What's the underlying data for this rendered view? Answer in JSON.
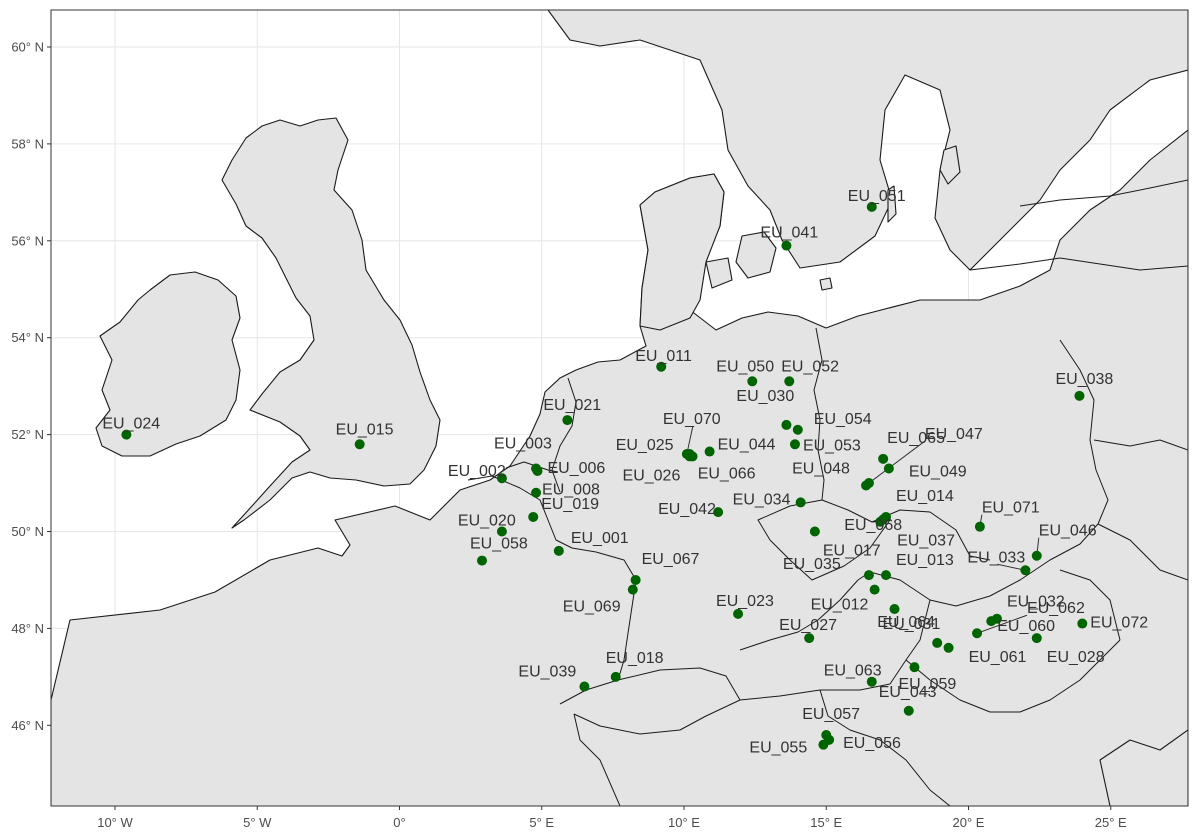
{
  "map": {
    "x_range": [
      -11,
      27
    ],
    "y_range": [
      44.4,
      60.75
    ],
    "x_ticks": [
      {
        "value": -10,
        "label": "10° W"
      },
      {
        "value": -5,
        "label": "5° W"
      },
      {
        "value": 0,
        "label": "0°"
      },
      {
        "value": 5,
        "label": "5° E"
      },
      {
        "value": 10,
        "label": "10° E"
      },
      {
        "value": 15,
        "label": "15° E"
      },
      {
        "value": 20,
        "label": "20° E"
      },
      {
        "value": 25,
        "label": "25° E"
      }
    ],
    "y_ticks": [
      {
        "value": 46,
        "label": "46° N"
      },
      {
        "value": 48,
        "label": "48° N"
      },
      {
        "value": 50,
        "label": "50° N"
      },
      {
        "value": 52,
        "label": "52° N"
      },
      {
        "value": 54,
        "label": "54° N"
      },
      {
        "value": 56,
        "label": "56° N"
      },
      {
        "value": 58,
        "label": "58° N"
      },
      {
        "value": 60,
        "label": "60° N"
      }
    ],
    "colors": {
      "land": "#e4e4e4",
      "sea": "#ffffff",
      "outline": "#1a1a1a",
      "point": "#006400",
      "grid": "#e6e6e6",
      "label": "#333333"
    }
  },
  "sites": [
    {
      "id": "EU_001",
      "lon": 5.6,
      "lat": 49.6
    },
    {
      "id": "EU_002",
      "lon": 3.6,
      "lat": 51.1
    },
    {
      "id": "EU_003",
      "lon": 4.8,
      "lat": 51.3
    },
    {
      "id": "EU_006",
      "lon": 4.85,
      "lat": 51.25
    },
    {
      "id": "EU_008",
      "lon": 4.8,
      "lat": 50.8
    },
    {
      "id": "EU_011",
      "lon": 9.2,
      "lat": 53.4
    },
    {
      "id": "EU_012",
      "lon": 16.7,
      "lat": 48.8
    },
    {
      "id": "EU_013",
      "lon": 17.1,
      "lat": 49.1
    },
    {
      "id": "EU_014",
      "lon": 17.1,
      "lat": 50.3
    },
    {
      "id": "EU_015",
      "lon": -1.4,
      "lat": 51.8
    },
    {
      "id": "EU_017",
      "lon": 14.6,
      "lat": 50.0
    },
    {
      "id": "EU_018",
      "lon": 7.6,
      "lat": 47.0
    },
    {
      "id": "EU_019",
      "lon": 4.7,
      "lat": 50.3
    },
    {
      "id": "EU_020",
      "lon": 3.6,
      "lat": 50.0
    },
    {
      "id": "EU_021",
      "lon": 5.9,
      "lat": 52.3
    },
    {
      "id": "EU_023",
      "lon": 11.9,
      "lat": 48.3
    },
    {
      "id": "EU_024",
      "lon": -9.6,
      "lat": 52.0
    },
    {
      "id": "EU_025",
      "lon": 10.2,
      "lat": 51.6
    },
    {
      "id": "EU_026",
      "lon": 10.3,
      "lat": 51.55
    },
    {
      "id": "EU_027",
      "lon": 14.4,
      "lat": 47.8
    },
    {
      "id": "EU_028",
      "lon": 22.4,
      "lat": 47.8
    },
    {
      "id": "EU_030",
      "lon": 13.6,
      "lat": 52.2
    },
    {
      "id": "EU_031",
      "lon": 17.4,
      "lat": 48.4
    },
    {
      "id": "EU_032",
      "lon": 21.0,
      "lat": 48.2
    },
    {
      "id": "EU_033",
      "lon": 22.0,
      "lat": 49.2
    },
    {
      "id": "EU_034",
      "lon": 14.1,
      "lat": 50.6
    },
    {
      "id": "EU_035",
      "lon": 16.5,
      "lat": 49.1
    },
    {
      "id": "EU_037",
      "lon": 17.0,
      "lat": 50.25
    },
    {
      "id": "EU_038",
      "lon": 23.9,
      "lat": 52.8
    },
    {
      "id": "EU_039",
      "lon": 6.5,
      "lat": 46.8
    },
    {
      "id": "EU_041",
      "lon": 13.6,
      "lat": 55.9
    },
    {
      "id": "EU_042",
      "lon": 11.2,
      "lat": 50.4
    },
    {
      "id": "EU_043",
      "lon": 17.9,
      "lat": 46.3
    },
    {
      "id": "EU_044",
      "lon": 10.9,
      "lat": 51.65
    },
    {
      "id": "EU_046",
      "lon": 22.4,
      "lat": 49.5
    },
    {
      "id": "EU_047",
      "lon": 16.5,
      "lat": 51.0
    },
    {
      "id": "EU_048",
      "lon": 16.4,
      "lat": 50.95
    },
    {
      "id": "EU_049",
      "lon": 17.2,
      "lat": 51.3
    },
    {
      "id": "EU_050",
      "lon": 12.4,
      "lat": 53.1
    },
    {
      "id": "EU_051",
      "lon": 16.6,
      "lat": 56.7
    },
    {
      "id": "EU_052",
      "lon": 13.7,
      "lat": 53.1
    },
    {
      "id": "EU_053",
      "lon": 13.9,
      "lat": 51.8
    },
    {
      "id": "EU_054",
      "lon": 14.0,
      "lat": 52.1
    },
    {
      "id": "EU_055",
      "lon": 14.9,
      "lat": 45.6
    },
    {
      "id": "EU_056",
      "lon": 15.1,
      "lat": 45.7
    },
    {
      "id": "EU_057",
      "lon": 15.0,
      "lat": 45.8
    },
    {
      "id": "EU_058",
      "lon": 2.9,
      "lat": 49.4
    },
    {
      "id": "EU_059",
      "lon": 18.1,
      "lat": 47.2
    },
    {
      "id": "EU_060",
      "lon": 20.8,
      "lat": 48.15
    },
    {
      "id": "EU_061",
      "lon": 19.3,
      "lat": 47.6
    },
    {
      "id": "EU_062",
      "lon": 20.3,
      "lat": 47.9
    },
    {
      "id": "EU_063",
      "lon": 16.6,
      "lat": 46.9
    },
    {
      "id": "EU_064",
      "lon": 18.9,
      "lat": 47.7
    },
    {
      "id": "EU_065",
      "lon": 17.0,
      "lat": 51.5
    },
    {
      "id": "EU_066",
      "lon": 10.2,
      "lat": 51.55
    },
    {
      "id": "EU_067",
      "lon": 8.3,
      "lat": 49.0
    },
    {
      "id": "EU_068",
      "lon": 16.9,
      "lat": 50.2
    },
    {
      "id": "EU_069",
      "lon": 8.2,
      "lat": 48.8
    },
    {
      "id": "EU_070",
      "lon": 10.1,
      "lat": 51.6
    },
    {
      "id": "EU_071",
      "lon": 20.4,
      "lat": 50.1
    },
    {
      "id": "EU_072",
      "lon": 24.0,
      "lat": 48.1
    }
  ]
}
